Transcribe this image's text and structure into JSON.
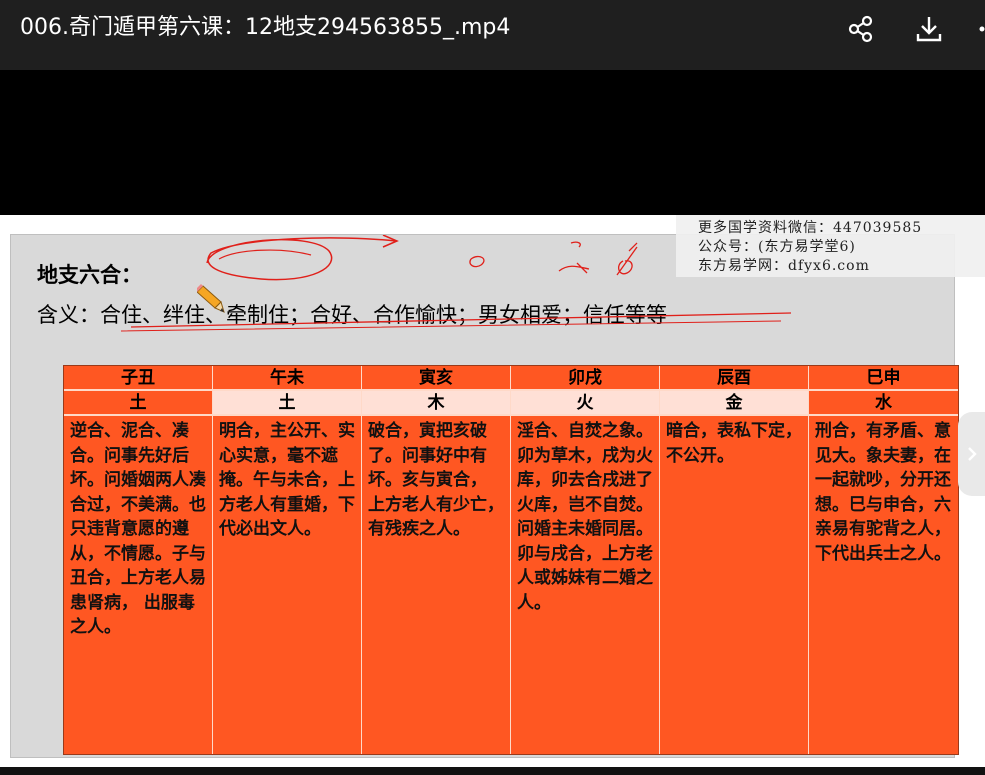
{
  "player": {
    "title": "006.奇门遁甲第六课：12地支294563855_.mp4"
  },
  "slide": {
    "heading": "地支六合：",
    "meaning": "含义：合住、绊住、牵制住；合好、合作愉快；男女相爱；信任等等",
    "watermark": {
      "line1": "更多国学资料微信：447039585",
      "line2": "公众号：(东方易学堂6)",
      "line3": "东方易学网：dfyx6.com"
    },
    "columns": [
      {
        "pair": "子丑",
        "element": "土",
        "desc": "逆合、泥合、凑合。问事先好后坏。问婚姻两人凑合过，不美满。也只违背意愿的遵从，不情愿。子与丑合，上方老人易患肾病， 出服毒之人。"
      },
      {
        "pair": "午未",
        "element": "土",
        "desc": "明合，主公开、实心实意，毫不遮掩。午与未合，上方老人有重婚，下代必出文人。"
      },
      {
        "pair": "寅亥",
        "element": "木",
        "desc": "破合，寅把亥破了。问事好中有坏。亥与寅合， 上方老人有少亡，有残疾之人。"
      },
      {
        "pair": "卯戌",
        "element": "火",
        "desc": "淫合、自焚之象。卯为草木，戌为火库，卯去合戌进了火库，岂不自焚。问婚主未婚同居。卯与戌合，上方老人或姊妹有二婚之人。"
      },
      {
        "pair": "辰酉",
        "element": "金",
        "desc": "暗合，表私下定，不公开。"
      },
      {
        "pair": "巳申",
        "element": "水",
        "desc": "刑合，有矛盾、意见大。象夫妻，在一起就吵，分开还想。巳与申合，六亲易有驼背之人，下代出兵士之人。"
      }
    ]
  },
  "colors": {
    "cell": "#ff5722",
    "cell_light": "#ffe0d6",
    "annotation": "#e0201a"
  }
}
